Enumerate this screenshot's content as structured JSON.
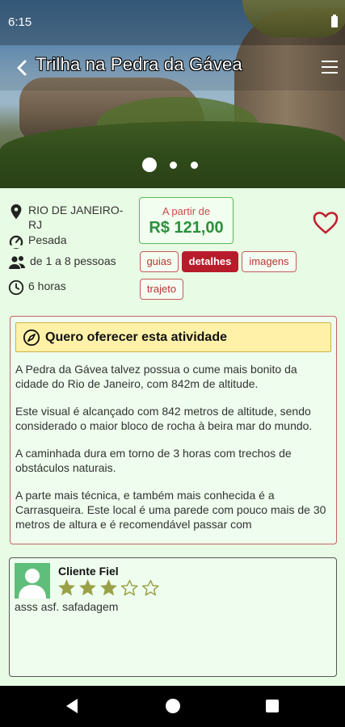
{
  "status_bar": {
    "time": "6:15"
  },
  "app_bar": {
    "title": "Trilha na Pedra da Gávea"
  },
  "info": {
    "location": "RIO DE JANEIRO-RJ",
    "difficulty": "Pesada",
    "group_size": "de 1 a 8 pessoas",
    "duration": "6 horas"
  },
  "price": {
    "caption": "A partir de",
    "value": "R$ 121,00"
  },
  "tabs": [
    {
      "label": "guias",
      "active": false
    },
    {
      "label": "detalhes",
      "active": true
    },
    {
      "label": "imagens",
      "active": false
    },
    {
      "label": "trajeto",
      "active": false
    }
  ],
  "offer": {
    "label": "Quero oferecer esta atividade"
  },
  "description": [
    "A Pedra da Gávea talvez possua o cume mais bonito da cidade do Rio de Janeiro, com 842m de altitude.",
    "Este visual é alcançado com 842 metros de altitude, sendo considerado o maior bloco de rocha à beira mar do mundo.",
    "A caminhada dura em torno de 3 horas com trechos de obstáculos naturais.",
    "A parte mais técnica, e também mais conhecida é a Carrasqueira. Este local é uma parede com pouco mais de 30 metros de altura e é recomendável passar com"
  ],
  "review": {
    "name": "Cliente Fiel",
    "rating": 3,
    "max_rating": 5,
    "text": "asss asf. safadagem"
  },
  "carousel": {
    "count": 3,
    "active_index": 0
  },
  "colors": {
    "background": "#e8fbe4",
    "accent_red": "#b71c2b",
    "price_green": "#2c8f3c",
    "star_olive": "#9aa046",
    "banner_yellow": "#fff2a8"
  }
}
